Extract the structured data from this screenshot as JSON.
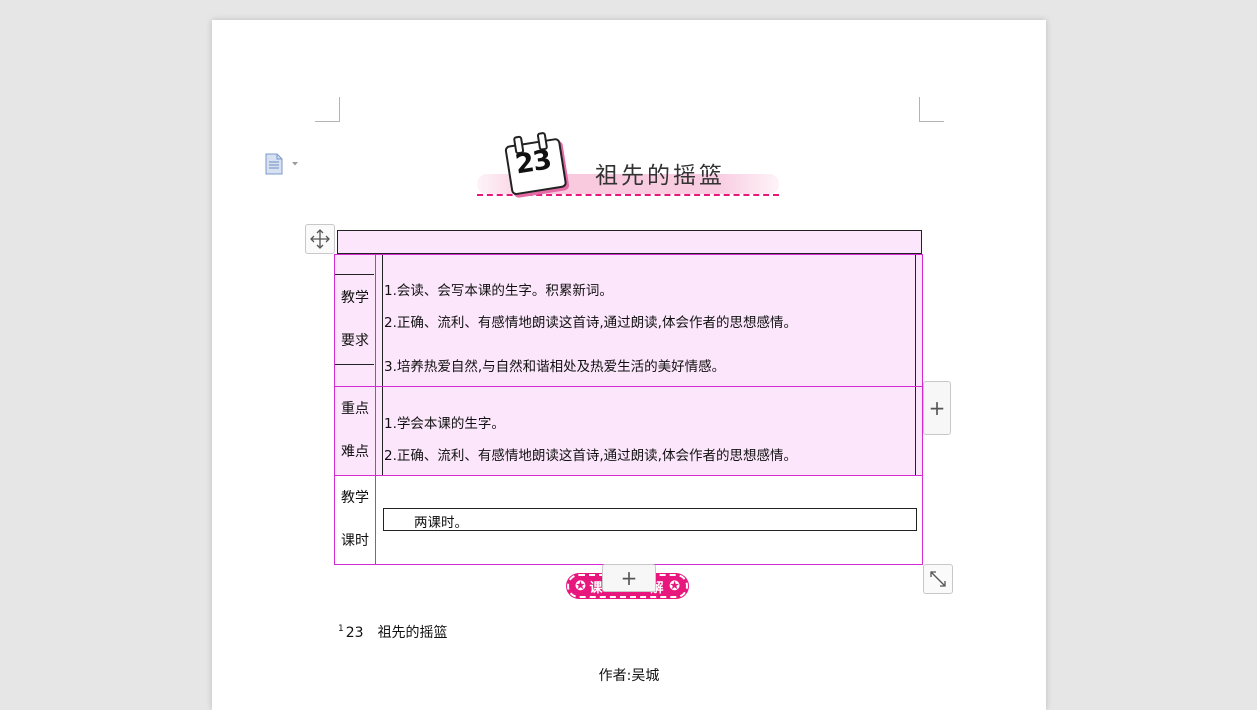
{
  "document": {
    "title_number": "23",
    "title_text": "祖先的摇篮",
    "table": {
      "rows": [
        {
          "label_line1": "教学",
          "label_line2": "要求",
          "items": [
            "1.会读、会写本课的生字。积累新词。",
            "2.正确、流利、有感情地朗读这首诗,通过朗读,体会作者的思想感情。",
            "3.培养热爱自然,与自然和谐相处及热爱生活的美好情感。"
          ]
        },
        {
          "label_line1": "重点",
          "label_line2": "难点",
          "items": [
            "1.学会本课的生字。",
            "2.正确、流利、有感情地朗读这首诗,通过朗读,体会作者的思想感情。"
          ]
        },
        {
          "label_line1": "教学",
          "label_line2": "课时",
          "items": [
            "两课时。"
          ]
        }
      ]
    },
    "badge": {
      "left_icon": "✪",
      "text_left": "课",
      "text_right": "解",
      "right_icon": "✪"
    },
    "footnote": {
      "marker": "1",
      "number": "23",
      "text": "祖先的摇篮"
    },
    "author": "作者:吴城"
  },
  "controls": {
    "add_symbol": "+"
  },
  "colors": {
    "accent_pink": "#e8177e",
    "cell_fill": "#fce6fb",
    "table_border": "#d42ad4"
  }
}
